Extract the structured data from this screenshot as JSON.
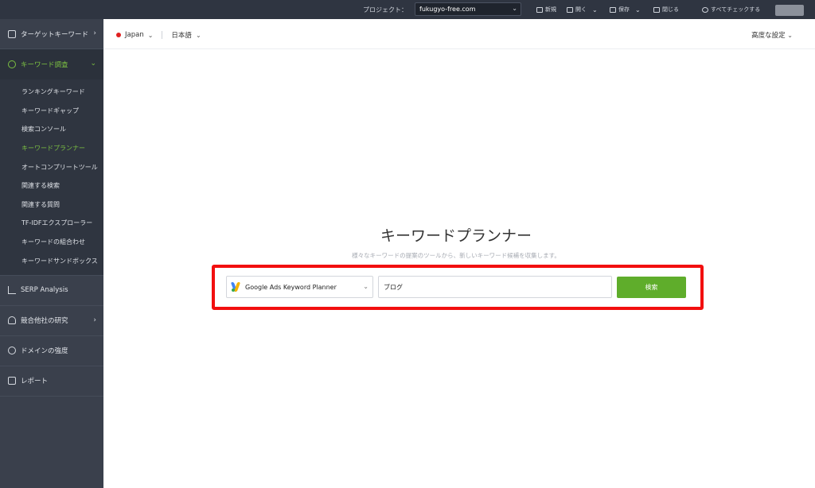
{
  "topbar": {
    "project_label": "プロジェクト：",
    "project_value": "fukugyo-free.com",
    "new_label": "新規",
    "open_label": "開く",
    "save_label": "保存",
    "close_label": "閉じる",
    "check_all_label": "すべてチェックする"
  },
  "sidebar": {
    "target_keywords": "ターゲットキーワード",
    "keyword_research": "キーワード調査",
    "sub_items": [
      "ランキングキーワード",
      "キーワードギャップ",
      "検索コンソール",
      "キーワードプランナー",
      "オートコンプリートツール",
      "関連する検索",
      "関連する質問",
      "TF-IDFエクスプローラー",
      "キーワードの組合わせ",
      "キーワードサンドボックス"
    ],
    "serp_analysis": "SERP Analysis",
    "competitor_research": "競合他社の研究",
    "domain_strength": "ドメインの強度",
    "report": "レポート"
  },
  "subheader": {
    "country": "Japan",
    "language": "日本語",
    "advanced": "高度な設定"
  },
  "main": {
    "title": "キーワードプランナー",
    "subtitle": "様々なキーワードの提案のツールから、新しいキーワード候補を収集します。",
    "tool_select": "Google Ads Keyword Planner",
    "keyword_value": "ブログ",
    "search_button": "検索"
  },
  "colors": {
    "accent_green": "#7cc142",
    "button_green": "#5fad2b",
    "highlight_red": "#f20f0f"
  }
}
